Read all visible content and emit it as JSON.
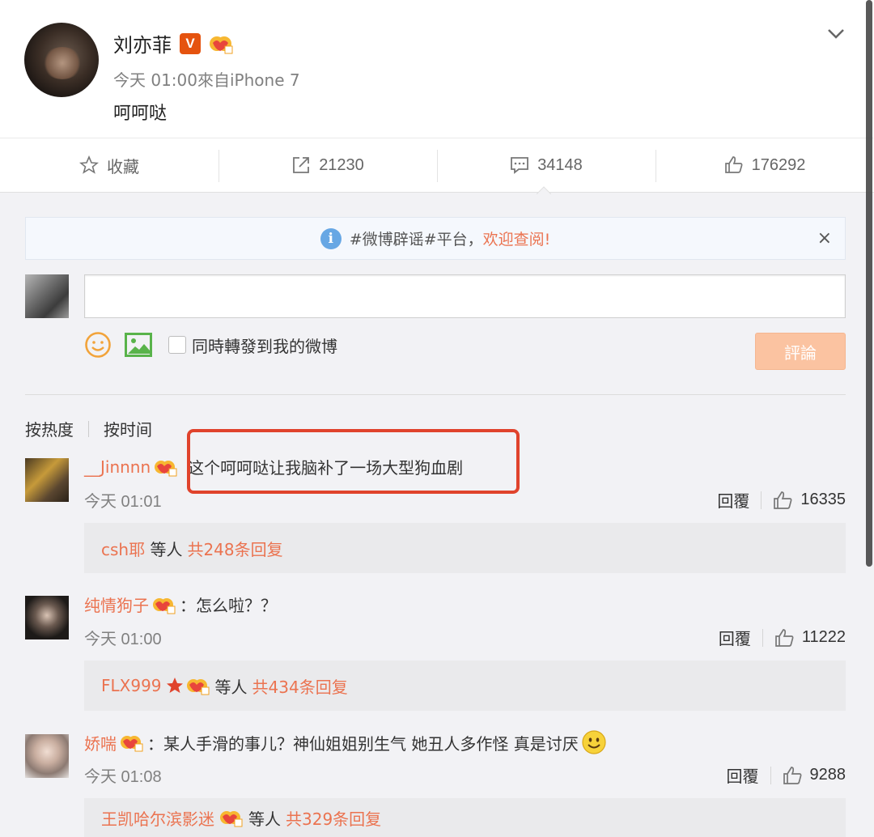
{
  "post": {
    "author": "刘亦菲",
    "verified_badge": "V",
    "time_source": "今天 01:00來自iPhone 7",
    "text": "呵呵哒"
  },
  "actions": {
    "favorite": "收藏",
    "repost_count": "21230",
    "comment_count": "34148",
    "like_count": "176292"
  },
  "notice": {
    "prefix": "#微博辟谣#平台，",
    "highlight": "欢迎查阅!",
    "close": "×"
  },
  "composer": {
    "placeholder": "",
    "repost_label": "同時轉發到我的微博",
    "submit_label": "評論"
  },
  "sort": {
    "hot": "按热度",
    "time": "按时间"
  },
  "comments": [
    {
      "user": "__Jinnnn",
      "text": "这个呵呵哒让我脑补了一场大型狗血剧",
      "time": "今天 01:01",
      "reply_label": "回覆",
      "likes": "16335",
      "replies_user": "csh耶",
      "replies_mid": "等人",
      "replies_count": "共248条回复"
    },
    {
      "user": "纯情狗子",
      "text": "：怎么啦？？",
      "time": "今天 01:00",
      "reply_label": "回覆",
      "likes": "11222",
      "replies_user": "FLX999",
      "replies_mid": "等人",
      "replies_count": "共434条回复"
    },
    {
      "user": "娇喘",
      "text": "：某人手滑的事儿？神仙姐姐别生气 她丑人多作怪 真是讨厌",
      "time": "今天 01:08",
      "reply_label": "回覆",
      "likes": "9288",
      "replies_user": "王凯哈尔滨影迷",
      "replies_mid": "等人",
      "replies_count": "共329条回复"
    }
  ],
  "colors": {
    "accent": "#eb7350",
    "highlight_box": "#e0432c",
    "submit_button": "#fbc3a1",
    "verified": "#e5530f"
  }
}
